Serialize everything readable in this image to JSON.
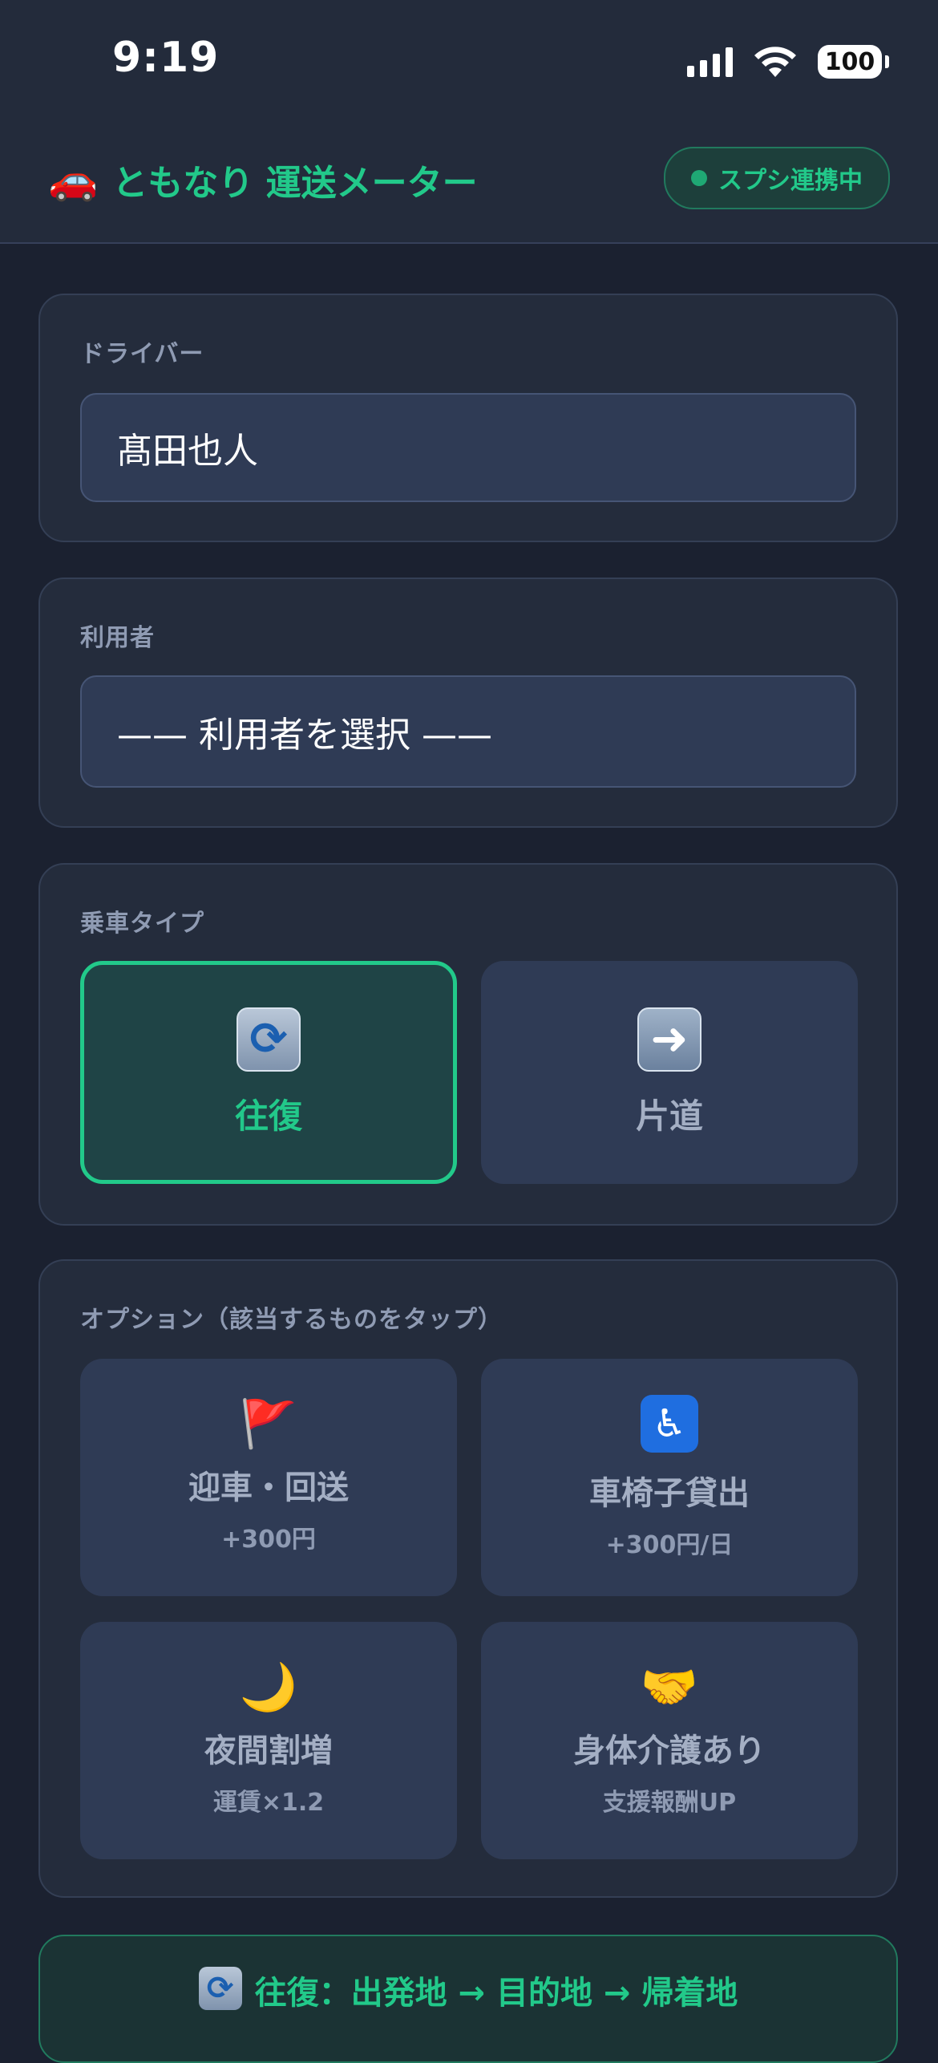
{
  "status_bar": {
    "time": "9:19",
    "battery": "100"
  },
  "header": {
    "title": "ともなり 運送メーター",
    "sync_badge": "スプシ連携中"
  },
  "driver": {
    "label": "ドライバー",
    "value": "髙田也人"
  },
  "user": {
    "label": "利用者",
    "value": "—— 利用者を選択 ——"
  },
  "ride_type": {
    "label": "乗車タイプ",
    "options": [
      {
        "icon": "round-trip-icon",
        "label": "往復",
        "selected": true
      },
      {
        "icon": "right-arrow-icon",
        "label": "片道",
        "selected": false
      }
    ]
  },
  "options": {
    "label": "オプション（該当するものをタップ）",
    "items": [
      {
        "icon": "flag-icon",
        "label": "迎車・回送",
        "sub": "+300円"
      },
      {
        "icon": "wheelchair-icon",
        "label": "車椅子貸出",
        "sub": "+300円/日"
      },
      {
        "icon": "moon-icon",
        "label": "夜間割増",
        "sub": "運賃×1.2"
      },
      {
        "icon": "handshake-icon",
        "label": "身体介護あり",
        "sub": "支援報酬UP"
      }
    ]
  },
  "route_banner": {
    "text": "往復：出発地 → 目的地 → 帰着地"
  },
  "colors": {
    "accent": "#22c98a",
    "background": "#1b2130",
    "card": "#242c3c"
  }
}
